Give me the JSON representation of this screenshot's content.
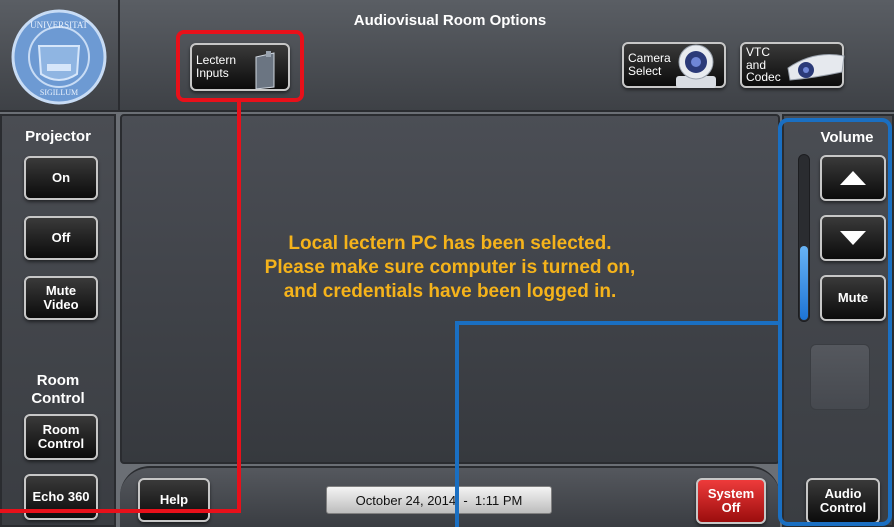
{
  "header": {
    "title": "Audiovisual Room Options"
  },
  "top_buttons": {
    "lectern": "Lectern\nInputs",
    "camera": "Camera\nSelect",
    "vtc": "VTC\nand\nCodec"
  },
  "left_panel": {
    "projector_label": "Projector",
    "on": "On",
    "off": "Off",
    "mute_video": "Mute\nVideo",
    "room_control_label": "Room\nControl",
    "room_control_button": "Room\nControl",
    "echo": "Echo 360"
  },
  "main": {
    "message_line1": "Local lectern PC has been selected.",
    "message_line2": "Please make sure computer is turned on,",
    "message_line3": "and credentials have been logged in."
  },
  "right_panel": {
    "volume_label": "Volume",
    "mute": "Mute",
    "audio_control": "Audio\nControl",
    "volume_level": 0.45
  },
  "footer": {
    "help": "Help",
    "datetime": "October 24, 2014  -  1:11 PM",
    "system_off": "System\nOff"
  },
  "colors": {
    "message": "#f5b31b",
    "annotation_red": "#e8101a",
    "annotation_blue": "#1a6fc2",
    "system_off": "#d21a1a"
  }
}
